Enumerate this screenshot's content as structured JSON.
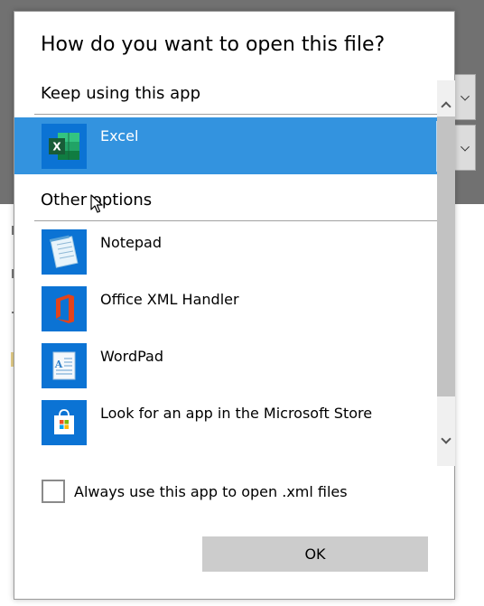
{
  "dialog": {
    "title": "How do you want to open this file?",
    "keep_using_heading": "Keep using this app",
    "other_options_heading": "Other options",
    "current_app": {
      "label": "Excel",
      "icon": "excel-icon",
      "selected": true
    },
    "other_apps": [
      {
        "label": "Notepad",
        "icon": "notepad-icon"
      },
      {
        "label": "Office XML Handler",
        "icon": "office-xml-handler-icon"
      },
      {
        "label": "WordPad",
        "icon": "wordpad-icon"
      },
      {
        "label": "Look for an app in the Microsoft Store",
        "icon": "microsoft-store-icon"
      }
    ],
    "always_use_label": "Always use this app to open .xml files",
    "always_use_checked": false,
    "ok_label": "OK"
  },
  "colors": {
    "selection": "#3393df",
    "icon_tile": "#0b73d4",
    "excel_green": "#1d7044",
    "office_orange": "#e3431a",
    "button_gray": "#cccccc"
  }
}
